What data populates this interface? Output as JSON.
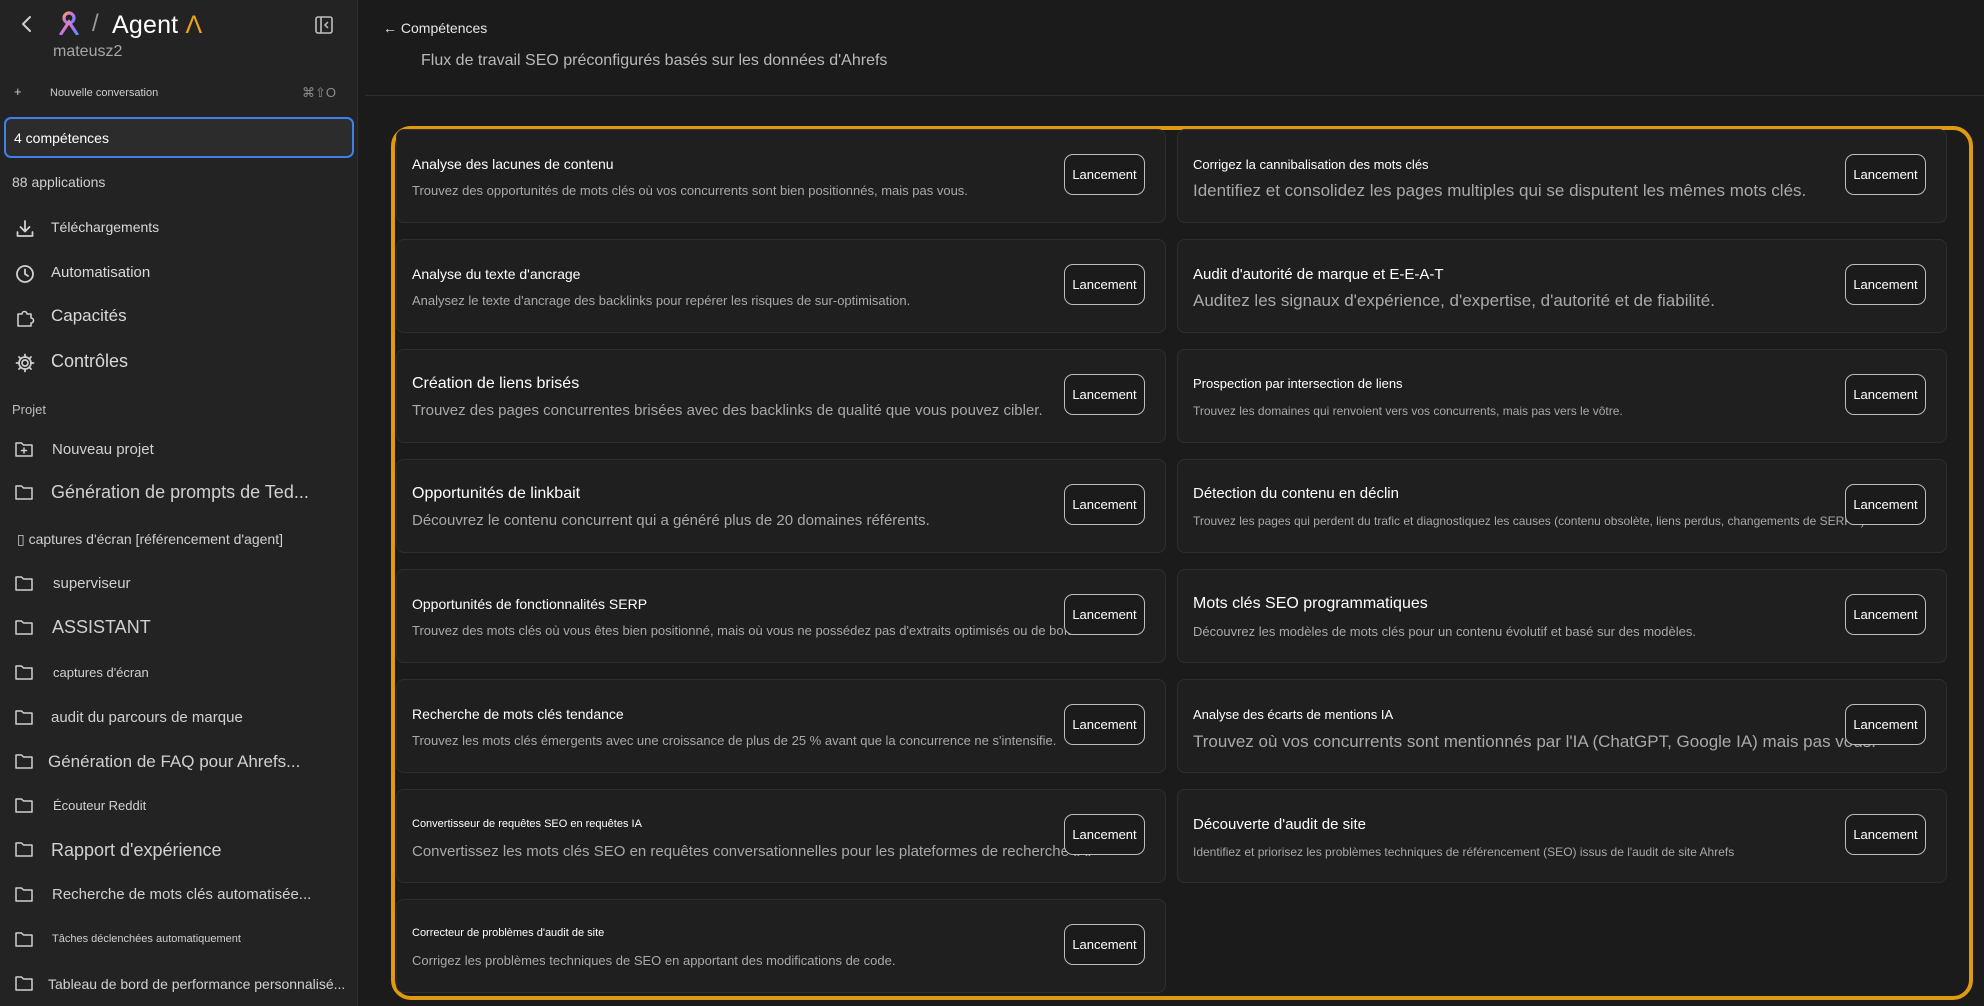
{
  "sidebar": {
    "brand_name": "Agent ",
    "brand_lambda": "Λ",
    "separator": "/",
    "username": "mateusz2",
    "new_conversation": {
      "icon": "+",
      "label": "Nouvelle conversation",
      "shortcut": "⌘⇧O"
    },
    "competences_filter": "4 compétences",
    "applications": "88 applications",
    "nav": [
      {
        "label": "Téléchargements",
        "icon": "download-icon"
      },
      {
        "label": "Automatisation",
        "icon": "clock-icon"
      },
      {
        "label": "Capacités",
        "icon": "puzzle-icon"
      },
      {
        "label": "Contrôles",
        "icon": "gear-icon"
      }
    ],
    "project_header": "Projet",
    "projects": [
      {
        "label": "Nouveau projet",
        "icon": "folder-plus-icon"
      },
      {
        "label": "Génération de prompts de Ted...",
        "icon": "folder-icon"
      },
      {
        "label": "▯ captures d'écran [référencement d'agent]",
        "icon": "none"
      },
      {
        "label": "superviseur",
        "icon": "folder-icon"
      },
      {
        "label": "ASSISTANT",
        "icon": "folder-icon"
      },
      {
        "label": "captures d'écran",
        "icon": "folder-icon"
      },
      {
        "label": "audit du parcours de marque",
        "icon": "folder-icon"
      },
      {
        "label": "Génération de FAQ pour Ahrefs...",
        "icon": "folder-icon"
      },
      {
        "label": "Écouteur Reddit",
        "icon": "folder-icon"
      },
      {
        "label": "Rapport d'expérience",
        "icon": "folder-icon"
      },
      {
        "label": "Recherche de mots clés automatisée...",
        "icon": "folder-icon"
      },
      {
        "label": "Tâches déclenchées automatiquement",
        "icon": "folder-icon"
      },
      {
        "label": "Tableau de bord de performance personnalisé...",
        "icon": "folder-icon"
      }
    ]
  },
  "main": {
    "breadcrumb": "← Compétences",
    "subtitle": "Flux de travail SEO préconfigurés basés sur les données d'Ahrefs",
    "launch_label": "Lancement",
    "skills": [
      {
        "title": "Analyse des lacunes de contenu",
        "desc": "Trouvez des opportunités de mots clés où vos concurrents sont bien positionnés, mais pas vous."
      },
      {
        "title": "Corrigez la cannibalisation des mots clés",
        "desc": "Identifiez et consolidez les pages multiples qui se disputent les mêmes mots clés."
      },
      {
        "title": "Analyse du texte d'ancrage",
        "desc": "Analysez le texte d'ancrage des backlinks pour repérer les risques de sur-optimisation."
      },
      {
        "title": "Audit d'autorité de marque et E-E-A-T",
        "desc": "Auditez les signaux d'expérience, d'expertise, d'autorité et de fiabilité."
      },
      {
        "title": "Création de liens brisés",
        "desc": "Trouvez des pages concurrentes brisées avec des backlinks de qualité que vous pouvez cibler."
      },
      {
        "title": "Prospection par intersection de liens",
        "desc": "Trouvez les domaines qui renvoient vers vos concurrents, mais pas vers le vôtre."
      },
      {
        "title": "Opportunités de linkbait",
        "desc": "Découvrez le contenu concurrent qui a généré plus de 20 domaines référents."
      },
      {
        "title": "Détection du contenu en déclin",
        "desc": "Trouvez les pages qui perdent du trafic et diagnostiquez les causes (contenu obsolète, liens perdus, changements de SERP...)"
      },
      {
        "title": "Opportunités de fonctionnalités SERP",
        "desc": "Trouvez des mots clés où vous êtes bien positionné, mais où vous ne possédez pas d'extraits optimisés ou de boîtes PAA."
      },
      {
        "title": "Mots clés SEO programmatiques",
        "desc": "Découvrez les modèles de mots clés pour un contenu évolutif et basé sur des modèles."
      },
      {
        "title": "Recherche de mots clés tendance",
        "desc": "Trouvez les mots clés émergents avec une croissance de plus de 25 % avant que la concurrence ne s'intensifie."
      },
      {
        "title": "Analyse des écarts de mentions IA",
        "desc": "Trouvez où vos concurrents sont mentionnés par l'IA (ChatGPT, Google IA) mais pas vous."
      },
      {
        "title": "Convertisseur de requêtes SEO en requêtes IA",
        "desc": "Convertissez les mots clés SEO en requêtes conversationnelles pour les plateformes de recherche IA."
      },
      {
        "title": "Découverte d'audit de site",
        "desc": "Identifiez et priorisez les problèmes techniques de référencement (SEO) issus de l'audit de site Ahrefs"
      },
      {
        "title": "Correcteur de problèmes d'audit de site",
        "desc": "Corrigez les problèmes techniques de SEO en apportant des modifications de code."
      }
    ]
  },
  "colors": {
    "accent_frame": "#e09a10",
    "focus_border": "#3f80ea",
    "brand_lambda": "#f0a020"
  }
}
